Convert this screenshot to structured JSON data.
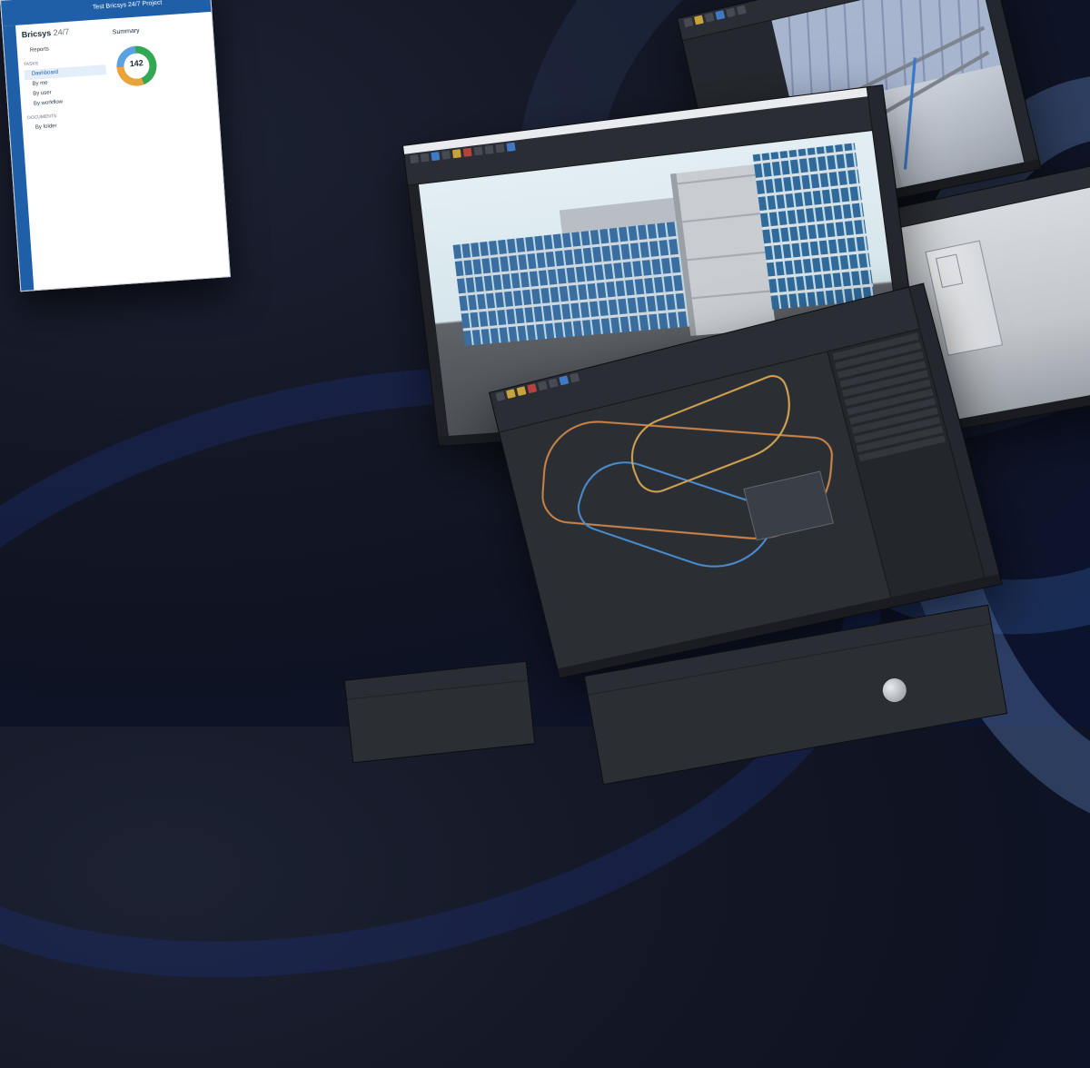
{
  "dashboard": {
    "brand": "Bricsys",
    "brand_suffix": "24/7",
    "project": "Test Bricsys 24/7 Project",
    "summary_title": "Summary",
    "task_count": "142",
    "nav": {
      "reports": "Reports",
      "tasks_section": "TASKS",
      "dashboard": "Dashboard",
      "by_me": "By me",
      "by_user": "By user",
      "by_workflow": "By workflow",
      "documents_section": "DOCUMENTS",
      "by_folder": "By folder"
    },
    "colors": {
      "accent": "#1e5fa8",
      "done": "#33a852",
      "pending": "#e8a33a",
      "open": "#5aa3e0"
    }
  },
  "icons": [
    "cad-tool-icon",
    "dashboard-icon",
    "reports-icon",
    "folder-icon"
  ]
}
